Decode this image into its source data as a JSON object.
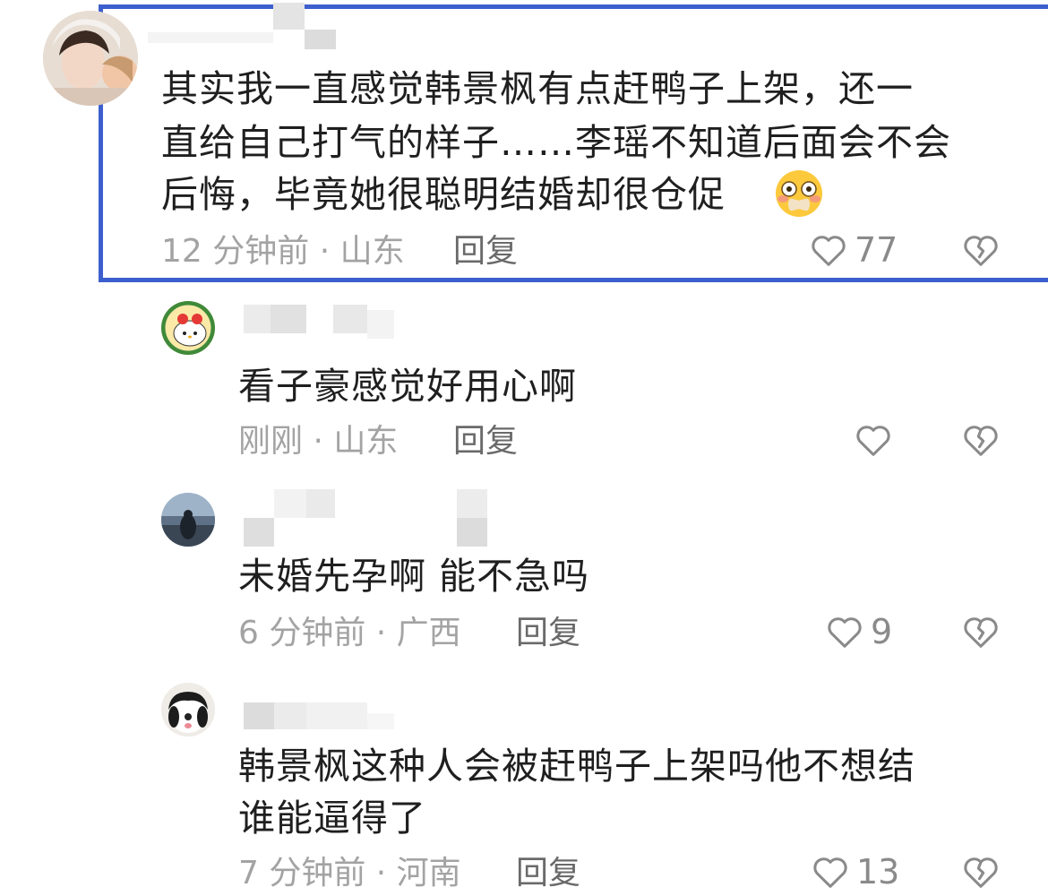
{
  "comments": [
    {
      "text_lines": [
        "其实我一直感觉韩景枫有点赶鸭子上架，还一",
        "直给自己打气的样子……李瑶不知道后面会不会",
        "后悔，毕竟她很聪明结婚却很仓促"
      ],
      "emoji": "😳",
      "time_location": "12 分钟前 · 山东",
      "reply_label": "回复",
      "likes": "77"
    },
    {
      "text_lines": [
        "看子豪感觉好用心啊"
      ],
      "time_location": "刚刚 · 山东",
      "reply_label": "回复",
      "likes": ""
    },
    {
      "text_lines": [
        "未婚先孕啊 能不急吗"
      ],
      "time_location": "6 分钟前 · 广西",
      "reply_label": "回复",
      "likes": "9"
    },
    {
      "text_lines": [
        "韩景枫这种人会被赶鸭子上架吗他不想结",
        "谁能逼得了"
      ],
      "time_location": "7 分钟前 · 河南",
      "reply_label": "回复",
      "likes": "13"
    }
  ],
  "colors": {
    "highlight_border": "#3d5fce",
    "text": "#1f1f1f",
    "meta": "#a3a3a3",
    "reply": "#6a6a6a"
  },
  "icons": [
    "heart-outline-icon",
    "broken-heart-icon",
    "flushed-face-emoji"
  ]
}
